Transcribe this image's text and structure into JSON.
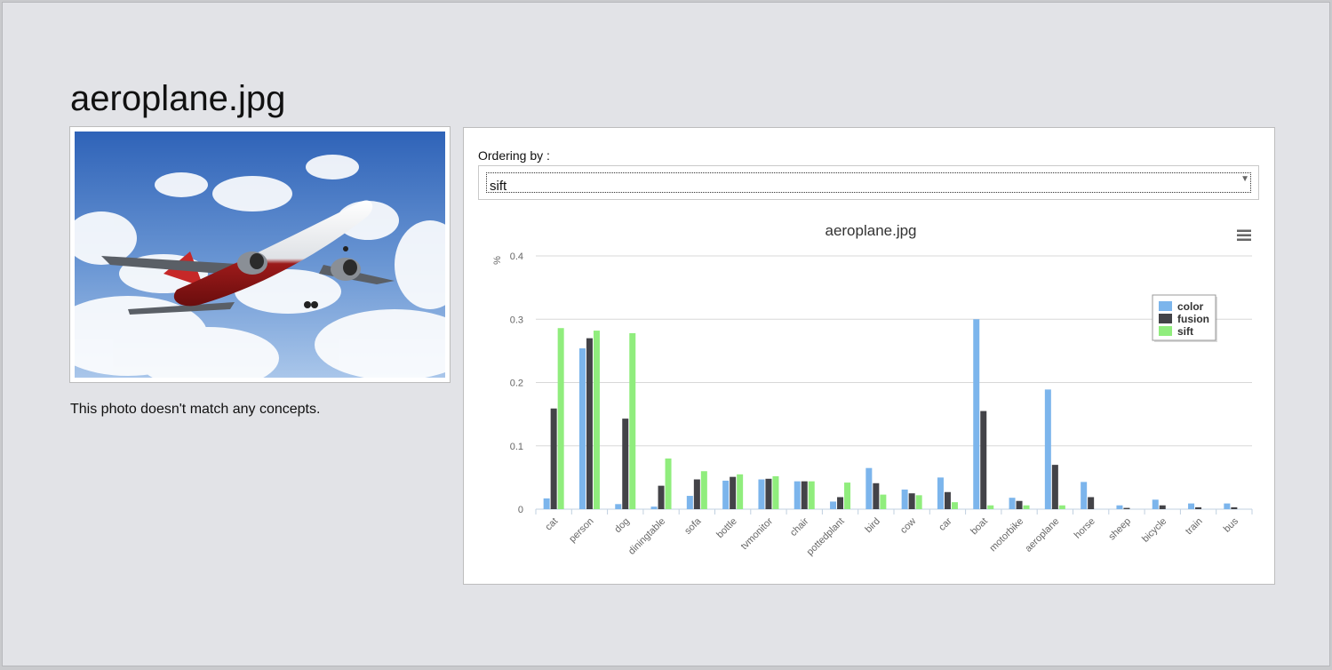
{
  "page": {
    "title": "aeroplane.jpg",
    "caption": "This photo doesn't match any concepts."
  },
  "ordering": {
    "label": "Ordering by :",
    "selected": "sift"
  },
  "colors": {
    "color": "#7cb5ec",
    "fusion": "#434348",
    "sift": "#90ed7d"
  },
  "icons": {
    "menu": "hamburger-menu-icon",
    "dropdown": "dropdown-arrow-icon"
  },
  "chart_data": {
    "type": "bar",
    "title": "aeroplane.jpg",
    "ylabel": "%",
    "ylim": [
      0,
      0.4
    ],
    "yticks": [
      "0",
      "0.1",
      "0.2",
      "0.3",
      "0.4"
    ],
    "grid": true,
    "legend_position": "top-right",
    "categories": [
      "cat",
      "person",
      "dog",
      "diningtable",
      "sofa",
      "bottle",
      "tvmonitor",
      "chair",
      "pottedplant",
      "bird",
      "cow",
      "car",
      "boat",
      "motorbike",
      "aeroplane",
      "horse",
      "sheep",
      "bicycle",
      "train",
      "bus"
    ],
    "series": [
      {
        "name": "color",
        "values": [
          0.017,
          0.254,
          0.008,
          0.004,
          0.021,
          0.045,
          0.047,
          0.044,
          0.012,
          0.065,
          0.031,
          0.05,
          0.3,
          0.018,
          0.189,
          0.043,
          0.006,
          0.015,
          0.009,
          0.009
        ]
      },
      {
        "name": "fusion",
        "values": [
          0.159,
          0.27,
          0.143,
          0.037,
          0.047,
          0.051,
          0.048,
          0.044,
          0.019,
          0.041,
          0.025,
          0.027,
          0.155,
          0.013,
          0.07,
          0.019,
          0.002,
          0.006,
          0.003,
          0.003
        ]
      },
      {
        "name": "sift",
        "values": [
          0.286,
          0.282,
          0.278,
          0.08,
          0.06,
          0.055,
          0.052,
          0.044,
          0.042,
          0.023,
          0.022,
          0.011,
          0.006,
          0.006,
          0.006,
          0.0,
          0.0,
          0.0,
          0.0,
          0.0
        ]
      }
    ]
  }
}
